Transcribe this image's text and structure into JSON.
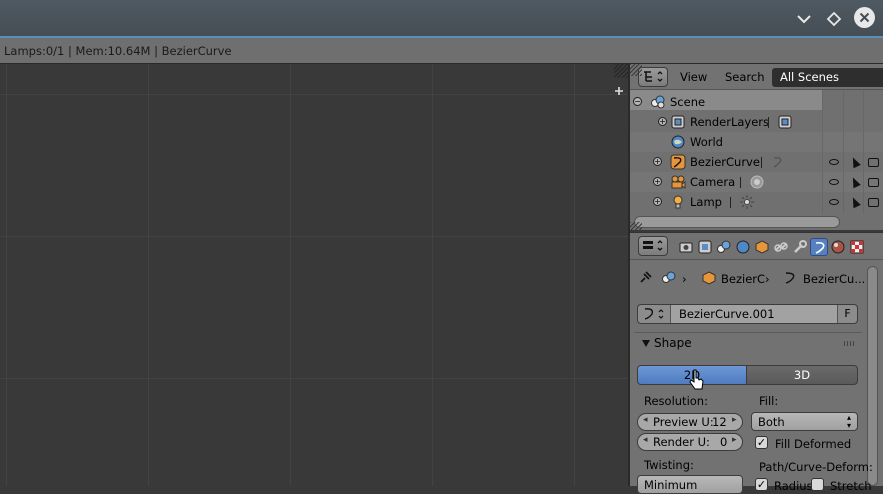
{
  "window": {
    "controls": [
      "chevron-down",
      "diamond",
      "close"
    ]
  },
  "info_bar": {
    "text": "Lamps:0/1 | Mem:10.64M | BezierCurve"
  },
  "outliner": {
    "menu": {
      "view": "View",
      "search": "Search"
    },
    "display_mode": "All Scenes",
    "items": [
      {
        "label": "Scene"
      },
      {
        "label": "RenderLayers"
      },
      {
        "label": "World"
      },
      {
        "label": "BezierCurve"
      },
      {
        "label": "Camera"
      },
      {
        "label": "Lamp"
      }
    ]
  },
  "properties": {
    "breadcrumb": {
      "object": "BezierC",
      "data": "BezierCu..."
    },
    "datablock": {
      "name": "BezierCurve.001",
      "fake_user": "F"
    },
    "panel": {
      "title": "Shape"
    },
    "dimensions": {
      "option_2d": "2D",
      "option_3d": "3D",
      "selected": "2D"
    },
    "resolution": {
      "label": "Resolution:",
      "preview_label": "Preview U:",
      "preview_value": "12",
      "render_label": "Render U:",
      "render_value": "0"
    },
    "fill": {
      "label": "Fill:",
      "value": "Both",
      "deformed_label": "Fill Deformed",
      "deformed_checked": true
    },
    "twisting": {
      "label": "Twisting:",
      "value": "Minimum"
    },
    "path_deform": {
      "label": "Path/Curve-Deform:",
      "radius_label": "Radius",
      "stretch_label": "Stretch"
    }
  },
  "colors": {
    "accent": "#5680c2",
    "titlebar": "#4b545b",
    "viewport": "#393939",
    "panel": "#727272"
  }
}
